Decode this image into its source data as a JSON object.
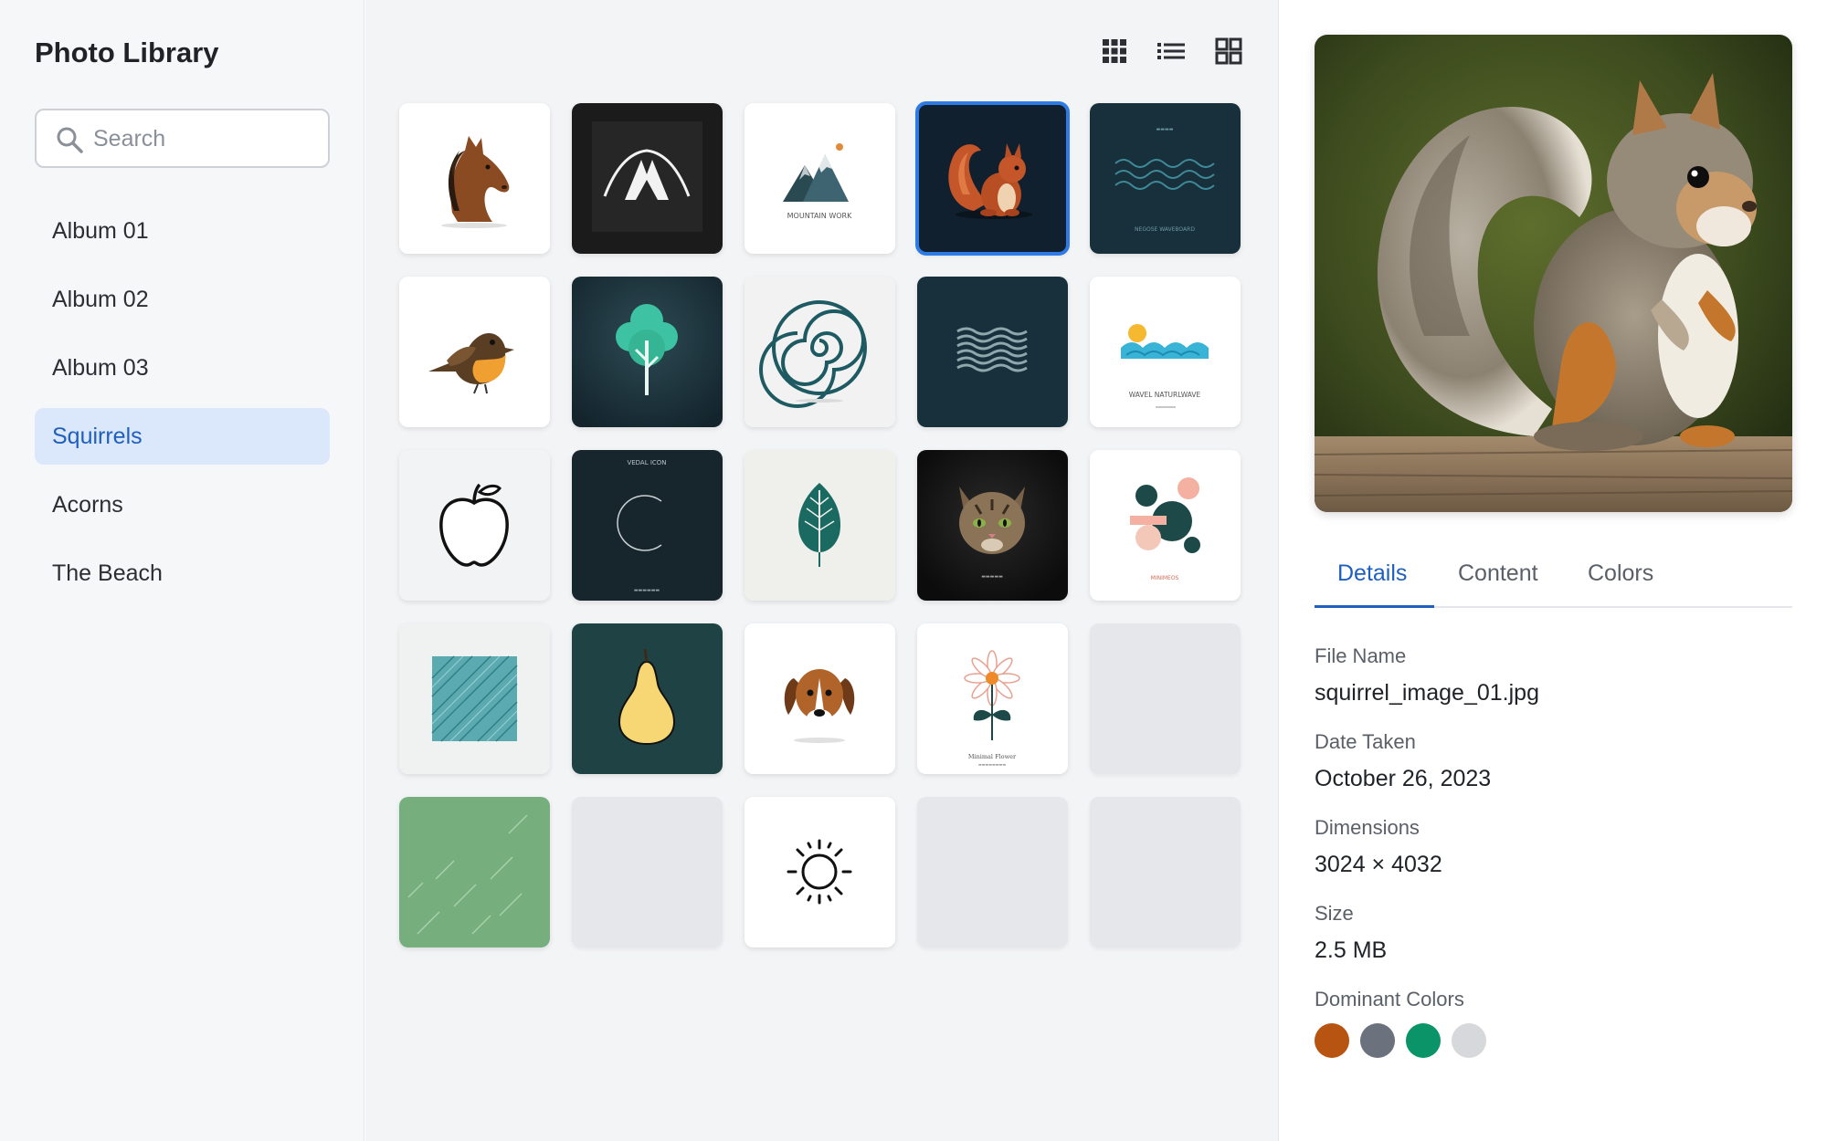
{
  "sidebar": {
    "title": "Photo Library",
    "search": {
      "placeholder": "Search",
      "value": ""
    },
    "items": [
      {
        "label": "Album 01",
        "active": false
      },
      {
        "label": "Album 02",
        "active": false
      },
      {
        "label": "Album 03",
        "active": false
      },
      {
        "label": "Squirrels",
        "active": true
      },
      {
        "label": "Acorns",
        "active": false
      },
      {
        "label": "The Beach",
        "active": false
      }
    ]
  },
  "toolbar": {
    "view_options": [
      "small-grid-icon",
      "list-icon",
      "large-grid-icon"
    ]
  },
  "grid": {
    "thumbnails": [
      {
        "subject": "horse",
        "caption": ""
      },
      {
        "subject": "tent-arch",
        "caption": ""
      },
      {
        "subject": "mountains",
        "caption": "MOUNTAIN WORK"
      },
      {
        "subject": "squirrel",
        "caption": "",
        "selected": true
      },
      {
        "subject": "waves-dark",
        "caption": "NEGOSE WAVEBOARD"
      },
      {
        "subject": "bird",
        "caption": ""
      },
      {
        "subject": "tree",
        "caption": ""
      },
      {
        "subject": "spiral",
        "caption": ""
      },
      {
        "subject": "wave-stripes",
        "caption": ""
      },
      {
        "subject": "sun-waves",
        "caption": "WAVEL NATURLWAVE"
      },
      {
        "subject": "apple",
        "caption": ""
      },
      {
        "subject": "moon",
        "caption": "VEDAL ICON"
      },
      {
        "subject": "leaf",
        "caption": ""
      },
      {
        "subject": "cat",
        "caption": ""
      },
      {
        "subject": "abstract-shapes",
        "caption": "MINIMEOS"
      },
      {
        "subject": "teal-texture",
        "caption": ""
      },
      {
        "subject": "pear",
        "caption": ""
      },
      {
        "subject": "dog",
        "caption": ""
      },
      {
        "subject": "flower",
        "caption": "Minimal Flower"
      },
      {
        "subject": "empty",
        "caption": ""
      },
      {
        "subject": "green-pattern",
        "caption": ""
      },
      {
        "subject": "empty",
        "caption": ""
      },
      {
        "subject": "sun",
        "caption": ""
      },
      {
        "subject": "empty",
        "caption": ""
      },
      {
        "subject": "empty",
        "caption": ""
      }
    ]
  },
  "details": {
    "tabs": [
      "Details",
      "Content",
      "Colors"
    ],
    "active_tab": "Details",
    "file_name_label": "File Name",
    "file_name": "squirrel_image_01.jpg",
    "date_label": "Date Taken",
    "date": "October 26, 2023",
    "dimensions_label": "Dimensions",
    "dimensions": "3024 × 4032",
    "size_label": "Size",
    "size": "2.5 MB",
    "colors_label": "Dominant Colors",
    "dominant_colors": [
      "#b85412",
      "#6b717d",
      "#0b9467",
      "#d6d8db"
    ]
  }
}
